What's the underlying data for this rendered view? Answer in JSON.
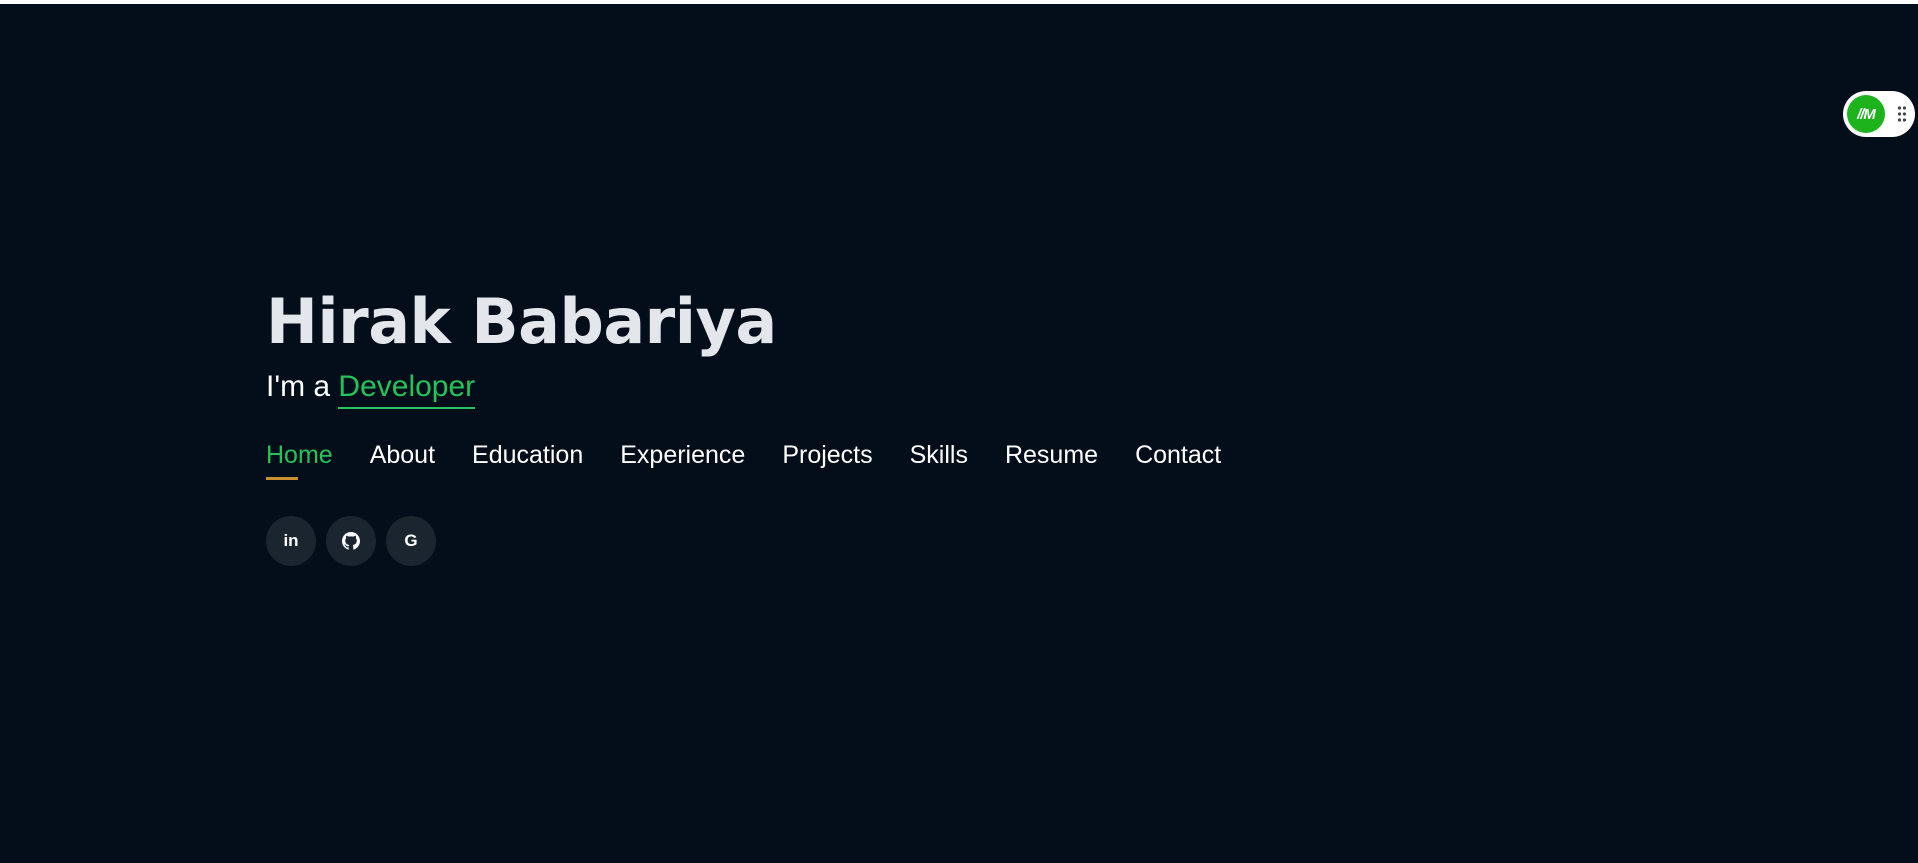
{
  "hero": {
    "name": "Hirak Babariya",
    "tagline_prefix": "I'm a ",
    "role": "Developer"
  },
  "nav": {
    "items": [
      {
        "label": "Home",
        "active": true
      },
      {
        "label": "About"
      },
      {
        "label": "Education"
      },
      {
        "label": "Experience"
      },
      {
        "label": "Projects"
      },
      {
        "label": "Skills"
      },
      {
        "label": "Resume"
      },
      {
        "label": "Contact"
      }
    ]
  },
  "social": {
    "linkedin_label": "in",
    "github_icon": "github-icon",
    "google_label": "G"
  },
  "widget": {
    "logo_text": "//M",
    "handle_icon": "drag-handle-icon"
  },
  "colors": {
    "background": "#040e1a",
    "accent": "#22c35a",
    "active_underline": "#c8902c",
    "name_text": "#e3e6ea",
    "social_bg": "#1b2530"
  }
}
